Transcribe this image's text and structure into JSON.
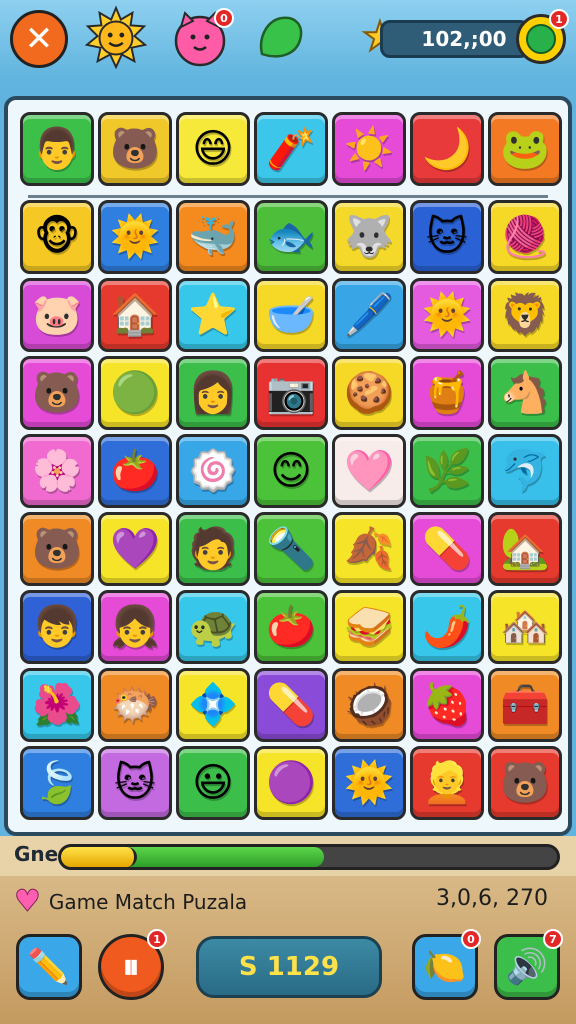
{
  "header": {
    "close_label": "✕",
    "score": "102,;00",
    "badges": {
      "pink_face": "0",
      "gem": "1"
    },
    "icons": [
      "sun-icon",
      "pink-face-icon",
      "green-leaf-icon",
      "star-icon",
      "gem-icon"
    ]
  },
  "board": {
    "rows": [
      [
        {
          "g": "👨",
          "c": "#3cc04a"
        },
        {
          "g": "🐻",
          "c": "#f0c82a"
        },
        {
          "g": "😄",
          "c": "#f7e93a"
        },
        {
          "g": "🧨",
          "c": "#3cc7ea"
        },
        {
          "g": "☀️",
          "c": "#e64bd8"
        },
        {
          "g": "🌙",
          "c": "#e83a3a"
        },
        {
          "g": "🐸",
          "c": "#f37a22"
        }
      ],
      [
        {
          "g": "🐵",
          "c": "#f6c824"
        },
        {
          "g": "🌞",
          "c": "#2f7fe0"
        },
        {
          "g": "🐳",
          "c": "#f58a1e"
        },
        {
          "g": "🐟",
          "c": "#4cbe3a"
        },
        {
          "g": "🐺",
          "c": "#f4d92a"
        },
        {
          "g": "🐱",
          "c": "#2a62d6"
        },
        {
          "g": "🧶",
          "c": "#f6d826"
        }
      ],
      [
        {
          "g": "🐷",
          "c": "#d84bd6"
        },
        {
          "g": "🏠",
          "c": "#e63a2e"
        },
        {
          "g": "⭐",
          "c": "#36c7ea"
        },
        {
          "g": "🥣",
          "c": "#f6d826"
        },
        {
          "g": "🖊️",
          "c": "#38a6e6"
        },
        {
          "g": "🌞",
          "c": "#e45be0"
        },
        {
          "g": "🦁",
          "c": "#f6d826"
        }
      ],
      [
        {
          "g": "🐻",
          "c": "#e64bd8"
        },
        {
          "g": "🟢",
          "c": "#f6e428"
        },
        {
          "g": "👩",
          "c": "#3cbf4a"
        },
        {
          "g": "📷",
          "c": "#e83232"
        },
        {
          "g": "🍪",
          "c": "#f6d826"
        },
        {
          "g": "🍯",
          "c": "#e64bd8"
        },
        {
          "g": "🐴",
          "c": "#3cbf4a"
        }
      ],
      [
        {
          "g": "🌸",
          "c": "#f06ad0"
        },
        {
          "g": "🍅",
          "c": "#2f6ed8"
        },
        {
          "g": "🍥",
          "c": "#37a7e8"
        },
        {
          "g": "😊",
          "c": "#4cc23a"
        },
        {
          "g": "🩷",
          "c": "#f7ecea"
        },
        {
          "g": "🌿",
          "c": "#3cbf4a"
        },
        {
          "g": "🐬",
          "c": "#38c0ea"
        }
      ],
      [
        {
          "g": "🐻",
          "c": "#f08a24"
        },
        {
          "g": "💜",
          "c": "#f6e428"
        },
        {
          "g": "🧑",
          "c": "#3cbf4a"
        },
        {
          "g": "🔦",
          "c": "#4cc23a"
        },
        {
          "g": "🍂",
          "c": "#f6e428"
        },
        {
          "g": "💊",
          "c": "#e64bd8"
        },
        {
          "g": "🏡",
          "c": "#e63a2e"
        }
      ],
      [
        {
          "g": "👦",
          "c": "#2f62d6"
        },
        {
          "g": "👧",
          "c": "#e64bd8"
        },
        {
          "g": "🐢",
          "c": "#36c7ea"
        },
        {
          "g": "🍅",
          "c": "#4cc23a"
        },
        {
          "g": "🥪",
          "c": "#f6e428"
        },
        {
          "g": "🌶️",
          "c": "#36c7ea"
        },
        {
          "g": "🏘️",
          "c": "#f6e428"
        }
      ],
      [
        {
          "g": "🌺",
          "c": "#36c7ea"
        },
        {
          "g": "🐡",
          "c": "#f08a24"
        },
        {
          "g": "💠",
          "c": "#f6e428"
        },
        {
          "g": "💊",
          "c": "#8a4bd8"
        },
        {
          "g": "🥥",
          "c": "#f08a24"
        },
        {
          "g": "🍓",
          "c": "#e64bd8"
        },
        {
          "g": "🧰",
          "c": "#f08a24"
        }
      ],
      [
        {
          "g": "🍃",
          "c": "#2f7fe0"
        },
        {
          "g": "🐱",
          "c": "#c46ae0"
        },
        {
          "g": "😃",
          "c": "#3cbf4a"
        },
        {
          "g": "🟣",
          "c": "#f6e428"
        },
        {
          "g": "🌞",
          "c": "#2f6ed8"
        },
        {
          "g": "👱",
          "c": "#e63a2e"
        },
        {
          "g": "🐻",
          "c": "#e63a2e"
        }
      ]
    ]
  },
  "progress": {
    "label": "Gne",
    "value": 0.53
  },
  "footer": {
    "title": "Game Match Puzala",
    "score": "3,0,6, 270",
    "coins": "S 1129",
    "buttons": [
      {
        "name": "hint-button",
        "glyph": "✏️",
        "color": "#3aa7e8"
      },
      {
        "name": "pause-button",
        "glyph": "⏸",
        "color": "#f05a1e",
        "badge": "1"
      },
      {
        "name": "lemon-button",
        "glyph": "🍋",
        "color": "#3aa7e8",
        "badge": "0"
      },
      {
        "name": "shuffle-button",
        "glyph": "🔊",
        "color": "#3cbf4a",
        "badge": "7"
      }
    ]
  }
}
